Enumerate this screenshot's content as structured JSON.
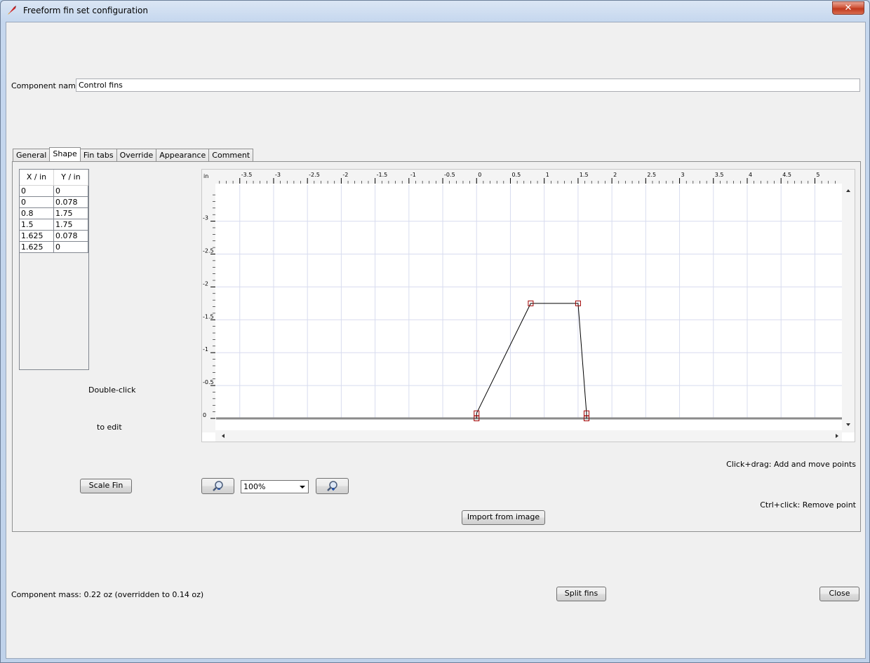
{
  "window": {
    "title": "Freeform fin set configuration",
    "close_glyph": "✕"
  },
  "component_name": {
    "label": "Component name:",
    "value": "Control fins"
  },
  "tabs": [
    {
      "label": "General",
      "active": false
    },
    {
      "label": "Shape",
      "active": true
    },
    {
      "label": "Fin tabs",
      "active": false
    },
    {
      "label": "Override",
      "active": false
    },
    {
      "label": "Appearance",
      "active": false
    },
    {
      "label": "Comment",
      "active": false
    }
  ],
  "points_table": {
    "headers": [
      "X / in",
      "Y / in"
    ],
    "rows": [
      [
        "0",
        "0"
      ],
      [
        "0",
        "0.078"
      ],
      [
        "0.8",
        "1.75"
      ],
      [
        "1.5",
        "1.75"
      ],
      [
        "1.625",
        "0.078"
      ],
      [
        "1.625",
        "0"
      ]
    ]
  },
  "hints": {
    "double_click": "Double-click",
    "to_edit": "to edit",
    "click_drag": "Click+drag: Add and move points",
    "ctrl_click": "Ctrl+click: Remove point"
  },
  "buttons": {
    "scale_fin": "Scale Fin",
    "import_image": "Import from image",
    "split_fins": "Split fins",
    "close": "Close"
  },
  "zoom": {
    "value": "100%"
  },
  "plot": {
    "unit_label": "in",
    "x_ticks": [
      "-3.5",
      "-3",
      "-2.5",
      "-2",
      "-1.5",
      "-1",
      "-0.5",
      "0",
      "0.5",
      "1",
      "1.5",
      "2",
      "2.5",
      "3",
      "3.5",
      "4",
      "4.5",
      "5"
    ],
    "y_ticks": [
      "-3",
      "-2.5",
      "-2",
      "-1.5",
      "-1",
      "-0.5",
      "0"
    ],
    "fin_points": [
      [
        0,
        0
      ],
      [
        0,
        0.078
      ],
      [
        0.8,
        1.75
      ],
      [
        1.5,
        1.75
      ],
      [
        1.625,
        0.078
      ],
      [
        1.625,
        0
      ]
    ],
    "x_range": [
      -3.85,
      5.4
    ],
    "y_range": [
      0,
      3.55
    ]
  },
  "mass": {
    "text": "Component mass: 0.22 oz (overridden to 0.14 oz)"
  }
}
